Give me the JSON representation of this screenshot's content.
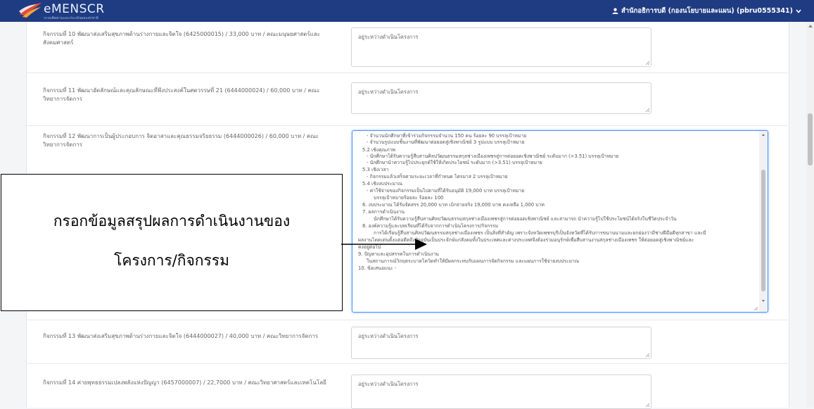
{
  "app": {
    "brand": "eMENSCR",
    "brand_sub": "ระบบติดตามและประเมินผลแห่งชาติ",
    "user": "สำนักอธิการบดี (กองนโยบายและแผน) (pbru0555341)"
  },
  "rows": [
    {
      "label": "กิจกรรมที่ 10 พัฒนาส่งเสริมสุขภาพด้านร่างกายและจิตใจ (6425000015) / 33,000 บาท / คณะมนุษยศาสตร์และสังคมศาสตร์",
      "value": "อยู่ระหว่างดำเนินโครงการ"
    },
    {
      "label": "กิจกรรมที่ 11 พัฒนาอัตลักษณ์และคุณลักษณะที่พึงประสงค์ในศตวรรษที่ 21 (6444000024) / 60,000 บาท / คณะวิทยาการจัดการ",
      "value": "อยู่ระหว่างดำเนินโครงการ"
    },
    {
      "label": "กิจกรรมที่ 12 พัฒนาการเป็นผู้ประกอบการ จิตอาสาและคุณธรรมจริยธรรม (6444000026) / 60,000 บาท / คณะวิทยาการจัดการ",
      "value": ""
    },
    {
      "label": "กิจกรรมที่ 13 พัฒนาส่งเสริมสุขภาพด้านร่างกายและจิตใจ (6444000027) / 40,000 บาท / คณะวิทยาการจัดการ",
      "value": "อยู่ระหว่างดำเนินโครงการ"
    },
    {
      "label": "กิจกรรมที่ 14 ค่ายพุทธธรรมเปลงพลังแห่งปัญญา (6457000007) / 22,7000 บาท / คณะวิทยาศาสตร์และเทคโนโลยี",
      "value": "อยู่ระหว่างดำเนินโครงการ"
    }
  ],
  "report_lines": [
    "- จำนวนนักศึกษาที่เข้าร่วมกิจกรรมจำนวน 150 คน                                    ร้อยละ 90              บรรลุเป้าหมาย",
    "- จำนวนรูปแบบชิ้นงานที่พัฒนาต่อยอดสู่เชิงพาณิชย์                                   3  รูปแบบ             บรรลุเป้าหมาย",
    "5.2 เชิงคุณภาพ",
    "- นักศึกษาได้รับความรู้สืบสานศิลปวัฒนธรรมสกุลช่างเมืองเพชรสู่การต่อยอดเชิงพาณิชย์  ระดับมาก (>3.51)      บรรลุเป้าหมาย",
    "- นักศึกษานำความรู้ไปประยุกต์ใช้ให้เกิดประโยชน์                                    ระดับมาก (>3.51)      บรรลุเป้าหมาย",
    "5.3 เชิงเวลา",
    "- กิจกรรมแล้วเสร็จตามระยะเวลาที่กำหนด                                              ไตรมาส 2              บรรลุเป้าหมาย",
    "5.4 เชิงงบประมาณ",
    "- ค่าใช้จ่ายของกิจกรรมเป็นไปตามที่ได้รับอนุมัติ                                          19,000 บาท            บรรลุเป้าหมาย",
    "บรรลุเป้าหมายร้อยละ  ร้อยละ 100",
    "6. งบประมาณ  ได้รับจัดสรร 20,000 บาท เบิกจ่ายจริง 19,000 บาท คงเหลือ 1,000 บาท",
    "7. ผลการดำเนินงาน",
    "นักศึกษาได้รับความรู้สืบสานศิลปวัฒนธรรมสกุลช่างเมืองเพชรสู่การต่อยอดเชิงพาณิชย์ และสามารถ   นำความรู้ไปใช้ประโยชน์ได้จริงในชีวิตประจำวัน",
    "8. องค์ความรู้และบทเรียนที่ได้รับจากการดำเนินโครงการ/กิจกรรม",
    "การได้เรียนรู้สืบสานศิลปวัฒนธรรมสกุลช่างเมืองเพชร เป็นสิ่งที่สำคัญ เพราะจังหวัดเพชรบุรีเป็นจังหวัดที่ได้รับการขนานนามและยกย่องว่ามีช่างฝีมือดีทุกสาขา และมี",
    "ผลงานโดดเด่นตั้งแต่อดีตถึงปัจจุบันเป็นประจักษ์แก่สังคมทั้งในประเทศและต่างประเทศจึงต้องร่วมอนุรักษ์เพื่อสืบสานงานสกุลช่างเมืองเพชร  ให้ต่อยอดสู่เชิงพาณิชย์และ",
    "คงอยู่ต่อไป",
    "9. ปัญหาและอุปสรรคในการดำเนินงาน",
    "ในสถานการณ์วิกฤตระบาดโควิดทำให้มีผลกระทบกับแผนการจัดกิจกรรม และแผนการใช้จ่ายงบประมาณ",
    "10. ข้อเสนอแนะ  -"
  ],
  "callout": {
    "line1": "กรอกข้อมูลสรุปผลการดำเนินงานของ",
    "line2": "โครงการ/กิจกรรม"
  }
}
